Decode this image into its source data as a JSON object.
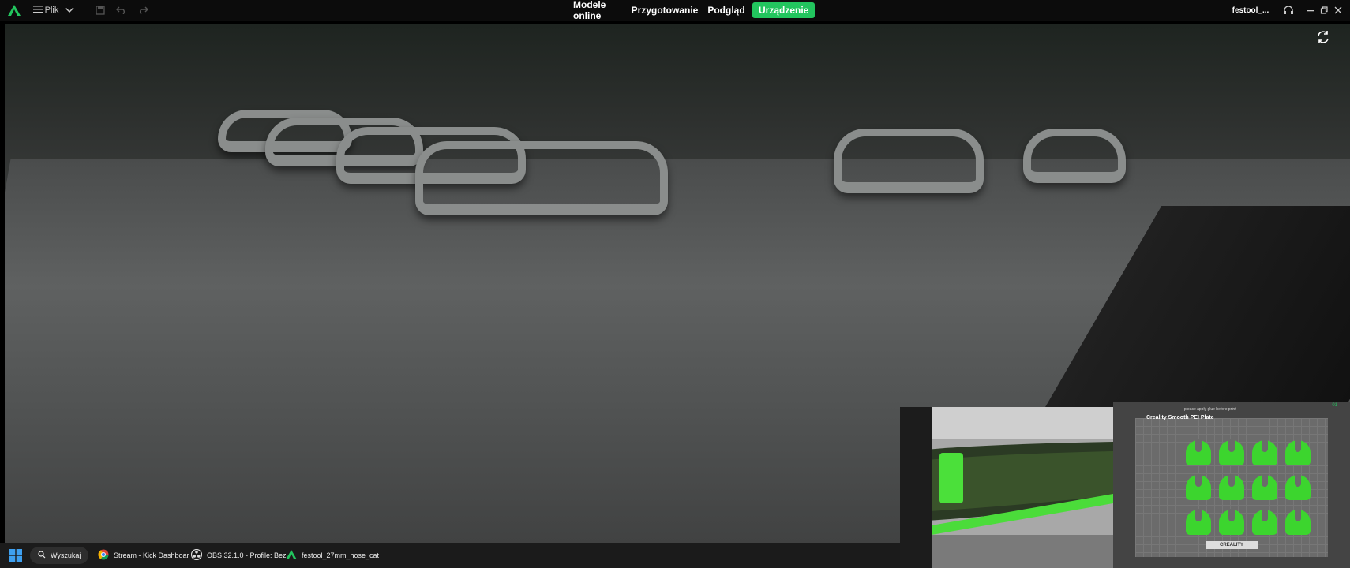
{
  "titlebar": {
    "menu_label": "Plik",
    "tabs": [
      {
        "label": "Modele online",
        "active": false
      },
      {
        "label": "Przygotowanie",
        "active": false
      },
      {
        "label": "Podgląd",
        "active": false
      },
      {
        "label": "Urządzenie",
        "active": true
      }
    ],
    "project_name": "festool_...",
    "accent_color": "#22c55e",
    "icons": [
      "creality-logo-icon",
      "hamburger-menu-icon",
      "chevron-down-icon",
      "save-icon",
      "undo-icon",
      "redo-icon",
      "headset-icon",
      "minimize-icon",
      "restore-icon",
      "close-icon"
    ]
  },
  "viewport": {
    "refresh_icon": "refresh-icon"
  },
  "taskbar": {
    "search_label": "Wyszukaj",
    "apps": [
      {
        "label": "Stream - Kick Dashboar",
        "icon": "chrome-icon"
      },
      {
        "label": "OBS 32.1.0 - Profile: Bez",
        "icon": "obs-icon"
      },
      {
        "label": "festool_27mm_hose_cat",
        "icon": "creality-icon"
      }
    ]
  },
  "overlay_slicer": {
    "plate_title": "Creality Smooth PEI Plate",
    "top_note": "please apply glue before print",
    "plate_number": "01",
    "brand_label": "CREALITY"
  }
}
